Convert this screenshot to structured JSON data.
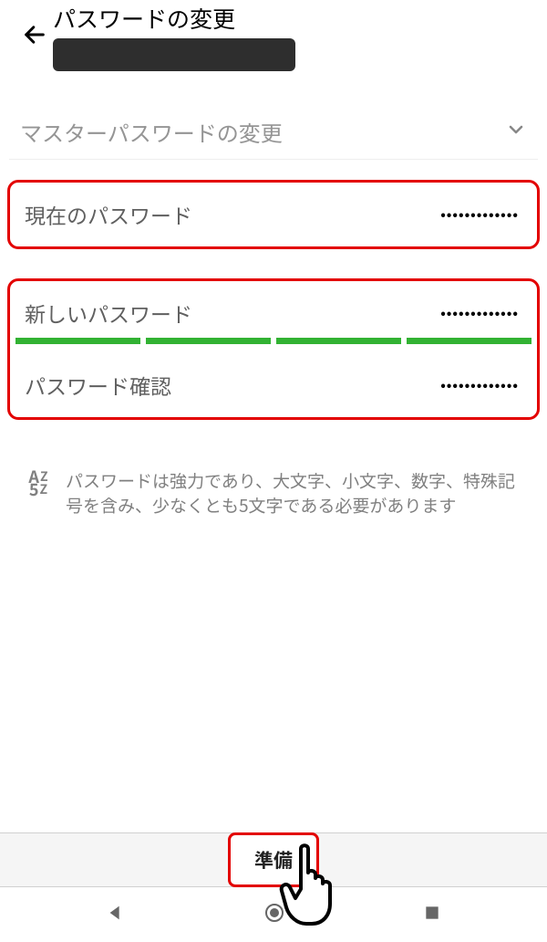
{
  "header": {
    "title": "パスワードの変更"
  },
  "section": {
    "label": "マスターパスワードの変更"
  },
  "fields": {
    "current": {
      "label": "現在のパスワード",
      "value": "•••••••••••••"
    },
    "new": {
      "label": "新しいパスワード",
      "value": "•••••••••••••"
    },
    "confirm": {
      "label": "パスワード確認",
      "value": "•••••••••••••"
    }
  },
  "hint": {
    "icon_line1": "A",
    "icon_line1b": "Z",
    "icon_line2": "5",
    "icon_line2b": "Z",
    "text": "パスワードは強力であり、大文字、小文字、数字、特殊記号を含み、少なくとも5文字である必要があります"
  },
  "action": {
    "ready": "準備"
  }
}
